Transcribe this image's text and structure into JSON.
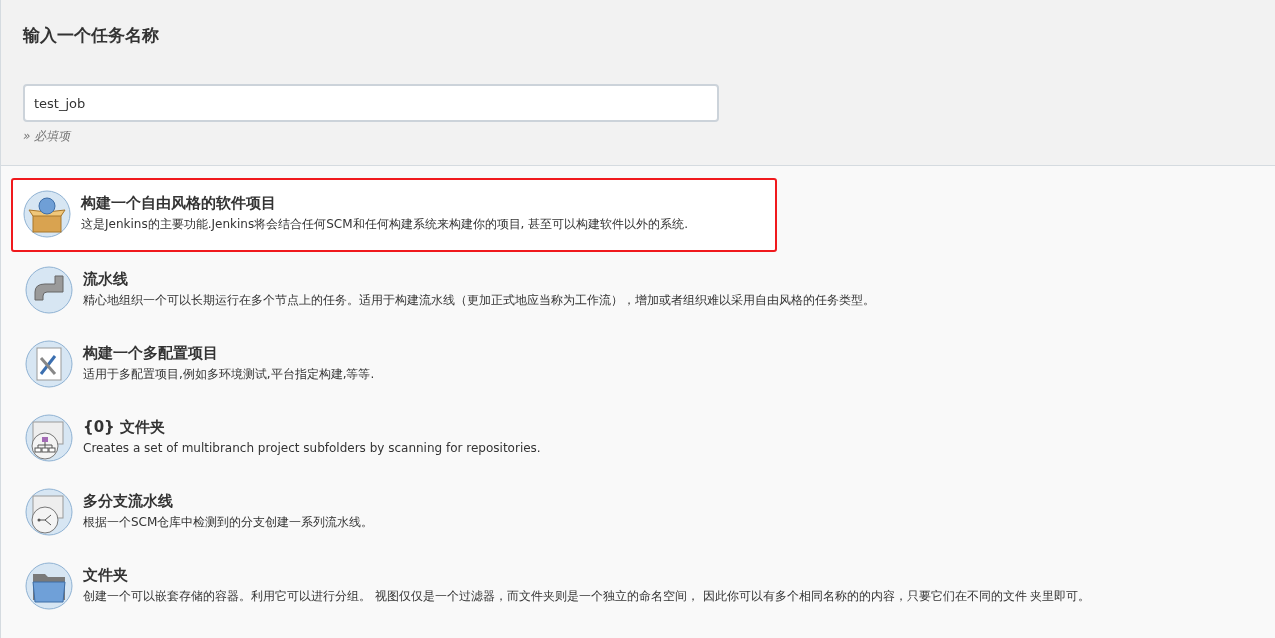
{
  "title": "输入一个任务名称",
  "name_field": {
    "value": "test_job"
  },
  "required_note": "» 必填项",
  "items": [
    {
      "kind": "freestyle",
      "title": "构建一个自由风格的软件项目",
      "description": "这是Jenkins的主要功能.Jenkins将会结合任何SCM和任何构建系统来构建你的项目, 甚至可以构建软件以外的系统.",
      "selected": true
    },
    {
      "kind": "pipeline",
      "title": "流水线",
      "description": "精心地组织一个可以长期运行在多个节点上的任务。适用于构建流水线（更加正式地应当称为工作流），增加或者组织难以采用自由风格的任务类型。",
      "selected": false
    },
    {
      "kind": "matrix",
      "title": "构建一个多配置项目",
      "description": "适用于多配置项目,例如多环境测试,平台指定构建,等等.",
      "selected": false
    },
    {
      "kind": "org-folder",
      "title": "{0} 文件夹",
      "description": "Creates a set of multibranch project subfolders by scanning for repositories.",
      "selected": false
    },
    {
      "kind": "multibranch",
      "title": "多分支流水线",
      "description": "根据一个SCM仓库中检测到的分支创建一系列流水线。",
      "selected": false
    },
    {
      "kind": "folder",
      "title": "文件夹",
      "description": "创建一个可以嵌套存储的容器。利用它可以进行分组。 视图仅仅是一个过滤器，而文件夹则是一个独立的命名空间， 因此你可以有多个相同名称的的内容，只要它们在不同的文件 夹里即可。",
      "selected": false
    }
  ]
}
